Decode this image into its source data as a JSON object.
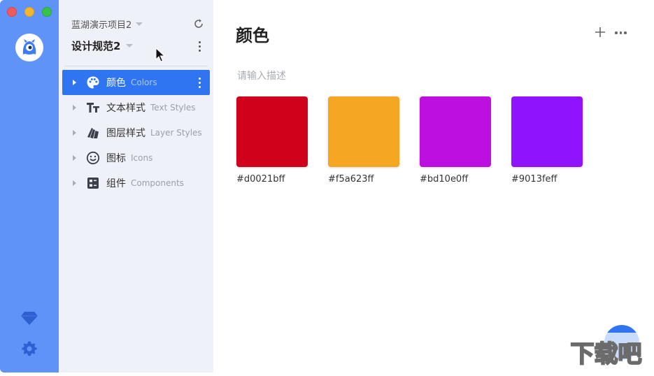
{
  "window": {
    "controls": [
      "close",
      "minimize",
      "maximize"
    ]
  },
  "rail": {
    "icons": [
      "app-logo-icon",
      "diamond-icon",
      "settings-gear-icon"
    ]
  },
  "sidebar": {
    "project_name": "蓝湖演示项目2",
    "spec_name": "设计规范2",
    "items": [
      {
        "zh": "颜色",
        "en": "Colors",
        "icon": "palette-icon",
        "active": true
      },
      {
        "zh": "文本样式",
        "en": "Text Styles",
        "icon": "text-style-icon",
        "active": false
      },
      {
        "zh": "图层样式",
        "en": "Layer Styles",
        "icon": "layer-style-icon",
        "active": false
      },
      {
        "zh": "图标",
        "en": "Icons",
        "icon": "smiley-icon",
        "active": false
      },
      {
        "zh": "组件",
        "en": "Components",
        "icon": "component-icon",
        "active": false
      }
    ]
  },
  "main": {
    "title": "颜色",
    "description_placeholder": "请输入描述",
    "colors": [
      {
        "hex_label": "#d0021bff",
        "color": "#d0021b"
      },
      {
        "hex_label": "#f5a623ff",
        "color": "#f5a623"
      },
      {
        "hex_label": "#bd10e0ff",
        "color": "#bd10e0"
      },
      {
        "hex_label": "#9013feff",
        "color": "#9013fe"
      }
    ]
  },
  "watermark": {
    "text": "下载吧"
  },
  "accent_color": "#2f74f0",
  "rail_color": "#5f93f7"
}
